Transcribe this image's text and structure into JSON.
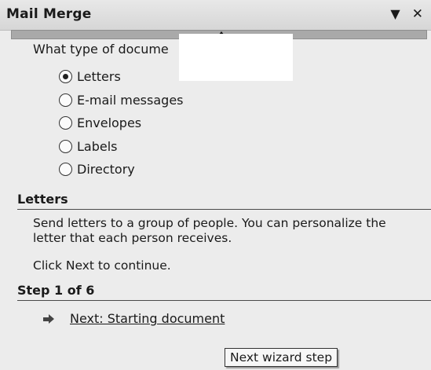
{
  "pane": {
    "title": "Mail Merge",
    "dropdown_glyph": "▼",
    "close_glyph": "✕"
  },
  "select_type": {
    "question": "What type of docume          ng on?",
    "options": [
      {
        "label": "Letters",
        "selected": true
      },
      {
        "label": "E-mail messages",
        "selected": false
      },
      {
        "label": "Envelopes",
        "selected": false
      },
      {
        "label": "Labels",
        "selected": false
      },
      {
        "label": "Directory",
        "selected": false
      }
    ]
  },
  "letters_section": {
    "heading": "Letters",
    "description": "Send letters to a group of people. You can personalize the letter that each person receives.",
    "instruction": "Click Next to continue."
  },
  "step_section": {
    "heading": "Step 1 of 6",
    "next_link": "Next: Starting document"
  },
  "tooltip": {
    "text": "Next wizard step"
  },
  "icons": {
    "dropdown": "chevron-down-icon",
    "close": "close-icon",
    "next": "arrow-right-icon",
    "resize": "resize-handle-icon"
  }
}
